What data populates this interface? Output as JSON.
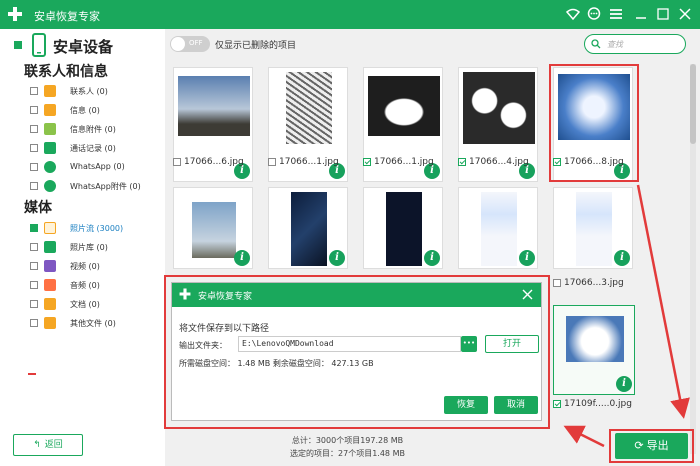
{
  "window": {
    "title": "安卓恢复专家",
    "icons": [
      "wifi-icon",
      "chat-icon",
      "menu-icon",
      "minimize-icon",
      "maximize-icon",
      "close-icon"
    ]
  },
  "sidebar": {
    "device_name": "安卓设备",
    "section_contacts": "联系人和信息",
    "section_media": "媒体",
    "contact_items": [
      {
        "label": "联系人 (0)",
        "color": "#f5a623"
      },
      {
        "label": "信息 (0)",
        "color": "#f5a623"
      },
      {
        "label": "信息附件 (0)",
        "color": "#8bc34a"
      },
      {
        "label": "通话记录 (0)",
        "color": "#1aa85c"
      },
      {
        "label": "WhatsApp (0)",
        "color": "#1aa85c"
      },
      {
        "label": "WhatsApp附件 (0)",
        "color": "#1aa85c"
      }
    ],
    "media_items": [
      {
        "label": "照片流 (3000)",
        "color": "#f5a623",
        "active": true
      },
      {
        "label": "照片库 (0)",
        "color": "#1aa85c"
      },
      {
        "label": "视频 (0)",
        "color": "#7e57c2"
      },
      {
        "label": "音频 (0)",
        "color": "#ff7043"
      },
      {
        "label": "文档 (0)",
        "color": "#f5a623"
      },
      {
        "label": "其他文件 (0)",
        "color": "#f5a623"
      }
    ],
    "back_label": "返回"
  },
  "toolbar": {
    "toggle_label": "OFF",
    "toggle_text": "仅显示已删除的项目",
    "search_placeholder": "查找"
  },
  "grid": {
    "row1": [
      {
        "label": "17066...6.jpg",
        "checked": false
      },
      {
        "label": "17066...1.jpg",
        "checked": false
      },
      {
        "label": "17066...1.jpg",
        "checked": true
      },
      {
        "label": "17066...4.jpg",
        "checked": true
      },
      {
        "label": "17066...8.jpg",
        "checked": true
      }
    ],
    "row2_visible_label": "17066...3.jpg",
    "row3_label": "17109f.....0.jpg"
  },
  "dialog": {
    "title": "安卓恢复专家",
    "prompt": "将文件保存到以下路径",
    "output_label": "输出文件夹：",
    "output_path": "E:\\LenovoQMDownload",
    "browse": "•••",
    "open_button": "打开",
    "space_text": "所需磁盘空间： 1.48 MB 剩余磁盘空间： 427.13 GB",
    "restore_button": "恢复",
    "cancel_button": "取消"
  },
  "footer": {
    "total": "总计：3000个项目197.28 MB",
    "selected": "选定的项目：27个项目1.48 MB",
    "export_button": "导出"
  },
  "colors": {
    "accent": "#1aa85c",
    "highlight": "#e23b3b"
  }
}
